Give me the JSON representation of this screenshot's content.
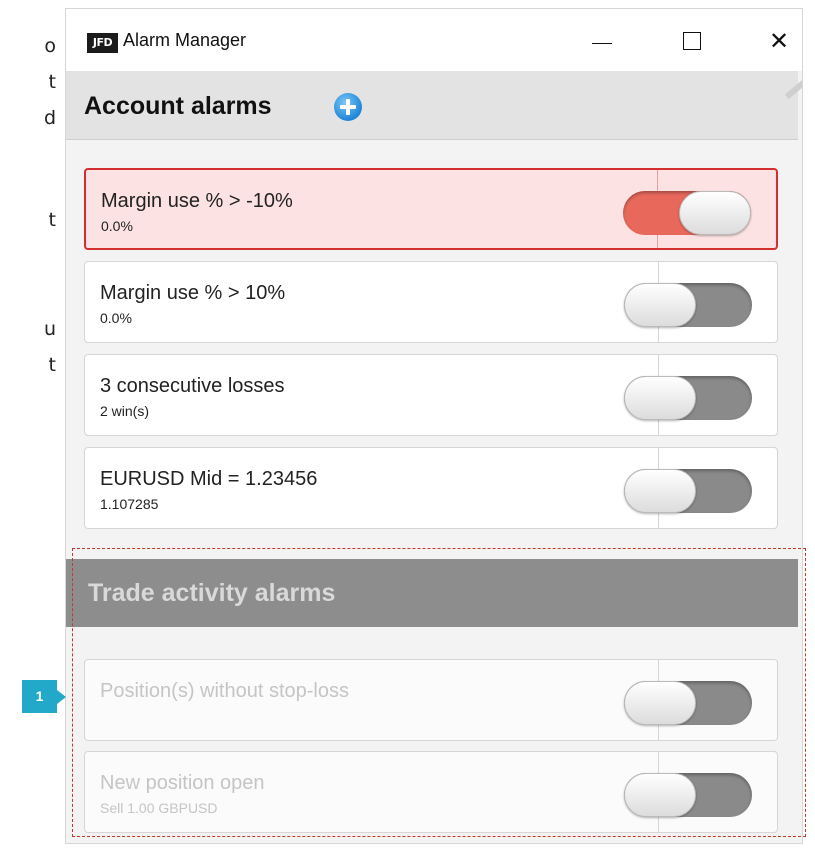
{
  "background_text": [
    "o",
    "t",
    "d",
    "t",
    "u",
    "t"
  ],
  "window": {
    "logo": "JFD",
    "title": "Alarm Manager",
    "controls": {
      "minimize": "—",
      "maximize": "☐",
      "close": "✕"
    }
  },
  "account_section": {
    "title": "Account alarms",
    "alarms": [
      {
        "label": "Margin use % > -10%",
        "sub": "0.0%",
        "enabled": true,
        "triggered": true
      },
      {
        "label": "Margin use % > 10%",
        "sub": "0.0%",
        "enabled": false,
        "triggered": false
      },
      {
        "label": "3 consecutive losses",
        "sub": "2 win(s)",
        "enabled": false,
        "triggered": false
      },
      {
        "label": "EURUSD Mid = 1.23456",
        "sub": "1.107285",
        "enabled": false,
        "triggered": false
      }
    ]
  },
  "trade_section": {
    "title": "Trade activity alarms",
    "alarms": [
      {
        "label": "Position(s) without stop-loss",
        "sub": "",
        "enabled": false
      },
      {
        "label": "New position open",
        "sub": "Sell 1.00 GBPUSD",
        "enabled": false
      }
    ]
  },
  "callout": {
    "number": "1"
  },
  "colors": {
    "toggle_on": "#e8695c",
    "toggle_off": "#8a8a8a",
    "alert_bg": "#fce2e2",
    "alert_border": "#d32f2f",
    "callout": "#22a9c9",
    "highlight_dash": "#c0392b"
  }
}
